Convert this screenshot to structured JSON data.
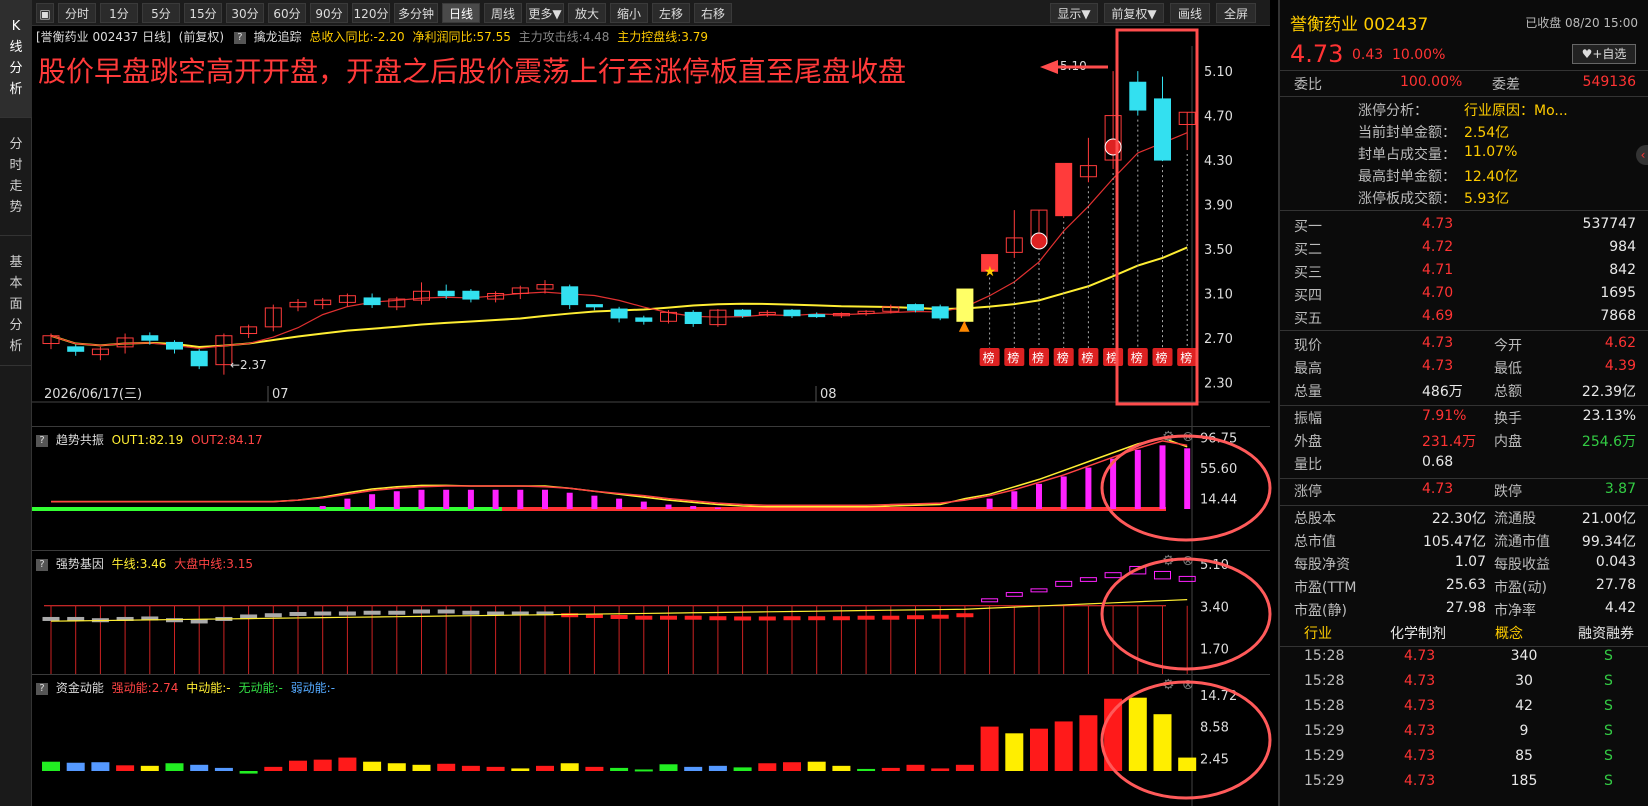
{
  "left_tabs": [
    {
      "label": "K线分析"
    },
    {
      "label": "分时走势"
    },
    {
      "label": "基本面分析"
    }
  ],
  "toolbar": {
    "periods": [
      "分时",
      "1分",
      "5分",
      "15分",
      "30分",
      "60分",
      "90分",
      "120分",
      "多分钟",
      "日线",
      "周线",
      "更多▼",
      "放大",
      "缩小",
      "左移",
      "右移"
    ],
    "active": "日线",
    "right": [
      "显示▼",
      "前复权▼",
      "画线",
      "全屏"
    ]
  },
  "main": {
    "stock_label": "[誉衡药业 002437 日线]",
    "adj": "(前复权)",
    "q": "?",
    "indicator": "擒龙追踪",
    "rev": "总收入同比:-2.20",
    "profit": "净利润同比:57.55",
    "atk": "主力攻击线:4.48",
    "ctrl": "主力控盘线:3.79",
    "annotation": "股价早盘跳空高开开盘，开盘之后股价震荡上行至涨停板直至尾盘收盘",
    "high_label": "5.10",
    "low_label": "2.37",
    "date_label": "2026/06/17(三)",
    "month_07": "07",
    "month_08": "08",
    "bang": "榜",
    "y_labels": [
      "5.10",
      "4.70",
      "4.30",
      "3.90",
      "3.50",
      "3.10",
      "2.70",
      "2.30"
    ]
  },
  "trend": {
    "name": "趋势共振",
    "out1": "OUT1:82.19",
    "out2": "OUT2:84.17",
    "y_labels": [
      "96.75",
      "55.60",
      "14.44"
    ]
  },
  "strong": {
    "name": "强势基因",
    "bull": "牛线:3.46",
    "mid": "大盘中线:3.15",
    "y_labels": [
      "5.10",
      "3.40",
      "1.70"
    ]
  },
  "fund": {
    "name": "资金动能",
    "strong": "强动能:2.74",
    "mid": "中动能:-",
    "none": "无动能:-",
    "weak": "弱动能:-",
    "y_labels": [
      "14.72",
      "8.58",
      "2.45"
    ]
  },
  "candles": [
    [
      2.65,
      2.72,
      2.62,
      2.6,
      2.74
    ],
    [
      2.62,
      2.58,
      2.56,
      2.54,
      2.64
    ],
    [
      2.55,
      2.6,
      2.52,
      2.5,
      2.62
    ],
    [
      2.62,
      2.7,
      2.58,
      2.56,
      2.74
    ],
    [
      2.72,
      2.68,
      2.65,
      2.64,
      2.75
    ],
    [
      2.66,
      2.6,
      2.58,
      2.56,
      2.68
    ],
    [
      2.58,
      2.45,
      2.43,
      2.42,
      2.6
    ],
    [
      2.46,
      2.72,
      2.44,
      2.37,
      2.74
    ],
    [
      2.74,
      2.8,
      2.72,
      2.7,
      2.82
    ],
    [
      2.8,
      2.97,
      2.78,
      2.76,
      3.0
    ],
    [
      2.98,
      3.02,
      2.95,
      2.94,
      3.05
    ],
    [
      3.0,
      3.04,
      2.97,
      2.96,
      3.06
    ],
    [
      3.02,
      3.08,
      2.99,
      2.98,
      3.1
    ],
    [
      3.06,
      3.0,
      2.98,
      2.97,
      3.1
    ],
    [
      2.98,
      3.05,
      2.95,
      2.95,
      3.07
    ],
    [
      3.04,
      3.12,
      3.02,
      3.0,
      3.2
    ],
    [
      3.12,
      3.08,
      3.05,
      3.05,
      3.18
    ],
    [
      3.12,
      3.05,
      3.03,
      3.02,
      3.14
    ],
    [
      3.05,
      3.1,
      3.03,
      3.02,
      3.12
    ],
    [
      3.1,
      3.15,
      3.06,
      3.05,
      3.17
    ],
    [
      3.14,
      3.18,
      3.1,
      3.1,
      3.22
    ],
    [
      3.16,
      3.0,
      2.98,
      2.96,
      3.18
    ],
    [
      3.0,
      2.98,
      2.95,
      2.95,
      3.0
    ],
    [
      2.96,
      2.88,
      2.86,
      2.84,
      2.98
    ],
    [
      2.88,
      2.85,
      2.82,
      2.82,
      2.9
    ],
    [
      2.85,
      2.93,
      2.83,
      2.84,
      2.95
    ],
    [
      2.93,
      2.83,
      2.8,
      2.8,
      2.95
    ],
    [
      2.82,
      2.95,
      2.8,
      2.8,
      2.96
    ],
    [
      2.95,
      2.9,
      2.88,
      2.88,
      2.96
    ],
    [
      2.92,
      2.93,
      2.9,
      2.89,
      2.95
    ],
    [
      2.95,
      2.9,
      2.88,
      2.88,
      2.96
    ],
    [
      2.91,
      2.9,
      2.89,
      2.88,
      2.93
    ],
    [
      2.9,
      2.92,
      2.88,
      2.88,
      2.93
    ],
    [
      2.92,
      2.94,
      2.9,
      2.9,
      2.95
    ],
    [
      2.94,
      2.98,
      2.92,
      2.92,
      3.0
    ],
    [
      3.0,
      2.95,
      2.93,
      2.93,
      3.01
    ],
    [
      2.98,
      2.88,
      2.86,
      2.86,
      3.0
    ],
    [
      2.85,
      3.14,
      2.83,
      2.82,
      3.14
    ],
    [
      3.3,
      3.45,
      3.28,
      3.3,
      3.45
    ],
    [
      3.47,
      3.6,
      3.43,
      3.42,
      3.85
    ],
    [
      3.55,
      3.85,
      3.5,
      3.5,
      3.85
    ],
    [
      3.8,
      4.27,
      3.78,
      3.78,
      4.27
    ],
    [
      4.15,
      4.25,
      4.12,
      4.1,
      4.5
    ],
    [
      4.3,
      4.7,
      4.28,
      4.22,
      5.1
    ],
    [
      5.0,
      4.75,
      4.73,
      4.7,
      5.1
    ],
    [
      4.85,
      4.3,
      4.29,
      4.29,
      5.05
    ],
    [
      4.62,
      4.73,
      4.45,
      4.39,
      4.73
    ]
  ],
  "trend_values": [
    0,
    0,
    0,
    0,
    0,
    0,
    0,
    0,
    0,
    0,
    0,
    4,
    14,
    20,
    24,
    26,
    26,
    26,
    26,
    26,
    26,
    22,
    18,
    14,
    10,
    6,
    4,
    2,
    0,
    0,
    0,
    0,
    0,
    0,
    0,
    0,
    0,
    0,
    14,
    24,
    34,
    44,
    56,
    68,
    80,
    86,
    82
  ],
  "trend_line1": [
    10,
    10,
    10,
    10,
    10,
    10,
    10,
    10,
    10,
    10,
    12,
    16,
    22,
    27,
    30,
    32,
    32,
    31,
    31,
    31,
    31,
    28,
    24,
    20,
    16,
    12,
    9,
    6,
    4,
    3,
    3,
    3,
    3,
    3,
    4,
    5,
    6,
    14,
    20,
    30,
    40,
    52,
    64,
    76,
    88,
    96,
    84
  ],
  "trend_line2": [
    10,
    10,
    10,
    10,
    10,
    10,
    10,
    10,
    10,
    10,
    12,
    15,
    20,
    25,
    28,
    30,
    31,
    31,
    31,
    31,
    30,
    28,
    24,
    21,
    18,
    14,
    11,
    8,
    6,
    5,
    5,
    5,
    5,
    5,
    6,
    7,
    8,
    12,
    18,
    26,
    36,
    46,
    58,
    70,
    82,
    92,
    86
  ],
  "strong_bars": [
    [
      2.9,
      2.95
    ],
    [
      2.9,
      2.95
    ],
    [
      2.85,
      2.9
    ],
    [
      2.9,
      2.95
    ],
    [
      2.92,
      2.97
    ],
    [
      2.86,
      2.9
    ],
    [
      2.78,
      2.85
    ],
    [
      2.85,
      2.95
    ],
    [
      2.95,
      3.05
    ],
    [
      3.05,
      3.1
    ],
    [
      3.1,
      3.15
    ],
    [
      3.12,
      3.17
    ],
    [
      3.12,
      3.17
    ],
    [
      3.15,
      3.2
    ],
    [
      3.15,
      3.2
    ],
    [
      3.2,
      3.25
    ],
    [
      3.2,
      3.25
    ],
    [
      3.15,
      3.2
    ],
    [
      3.12,
      3.17
    ],
    [
      3.12,
      3.17
    ],
    [
      3.12,
      3.17
    ],
    [
      3.05,
      3.1
    ],
    [
      3.02,
      3.07
    ],
    [
      2.98,
      3.03
    ],
    [
      2.95,
      3.0
    ],
    [
      2.95,
      3.0
    ],
    [
      2.95,
      3.0
    ],
    [
      2.93,
      2.98
    ],
    [
      2.92,
      2.97
    ],
    [
      2.92,
      2.97
    ],
    [
      2.93,
      2.98
    ],
    [
      2.93,
      2.98
    ],
    [
      2.93,
      2.98
    ],
    [
      2.95,
      3.0
    ],
    [
      2.95,
      3.0
    ],
    [
      2.96,
      3.02
    ],
    [
      2.98,
      3.04
    ],
    [
      3.0,
      3.1
    ],
    [
      3.6,
      3.7
    ],
    [
      3.8,
      3.95
    ],
    [
      4.0,
      4.1
    ],
    [
      4.2,
      4.4
    ],
    [
      4.4,
      4.55
    ],
    [
      4.55,
      4.75
    ],
    [
      4.7,
      5.0
    ],
    [
      4.5,
      4.8
    ],
    [
      4.4,
      4.6
    ]
  ],
  "fund_values": [
    1.8,
    1.6,
    1.7,
    1.1,
    1.0,
    1.5,
    1.2,
    0.6,
    -0.5,
    0.8,
    2.0,
    2.2,
    2.6,
    1.8,
    1.5,
    1.2,
    1.4,
    1.0,
    0.8,
    0.5,
    1.0,
    1.5,
    0.8,
    0.6,
    0.3,
    1.3,
    0.8,
    1.0,
    0.7,
    1.5,
    1.7,
    1.8,
    1.0,
    0.4,
    0.6,
    1.2,
    0.5,
    1.2,
    8.6,
    7.3,
    8.2,
    9.6,
    10.8,
    14.0,
    14.2,
    11.0,
    2.6
  ],
  "fund_colors": [
    "green",
    "blue",
    "blue",
    "red",
    "yellow",
    "green",
    "blue",
    "blue",
    "green",
    "red",
    "red",
    "red",
    "red",
    "yellow",
    "yellow",
    "yellow",
    "red",
    "red",
    "red",
    "yellow",
    "red",
    "yellow",
    "red",
    "green",
    "green",
    "green",
    "blue",
    "blue",
    "green",
    "red",
    "red",
    "yellow",
    "yellow",
    "green",
    "red",
    "red",
    "red",
    "red",
    "red",
    "yellow",
    "red",
    "red",
    "red",
    "red",
    "yellow",
    "yellow",
    "yellow"
  ],
  "right": {
    "title": "誉衡药业 002437",
    "status": "已收盘 08/20 15:00",
    "price": "4.73",
    "chg": "0.43",
    "pct": "10.00%",
    "self_btn": "+自选",
    "wb_label": "委比",
    "wb_val": "100.00%",
    "wc_label": "委差",
    "wc_val": "549136",
    "limit": [
      {
        "k": "涨停分析：",
        "v": "行业原因：Mo..."
      },
      {
        "k": "当前封单金额：",
        "v": "2.54亿"
      },
      {
        "k": "封单占成交量：",
        "v": "11.07%"
      },
      {
        "k": "最高封单金额：",
        "v": "12.40亿"
      },
      {
        "k": "涨停板成交额：",
        "v": "5.93亿"
      }
    ],
    "bids": [
      {
        "k": "买一",
        "p": "4.73",
        "v": "537747"
      },
      {
        "k": "买二",
        "p": "4.72",
        "v": "984"
      },
      {
        "k": "买三",
        "p": "4.71",
        "v": "842"
      },
      {
        "k": "买四",
        "p": "4.70",
        "v": "1695"
      },
      {
        "k": "买五",
        "p": "4.69",
        "v": "7868"
      }
    ],
    "stats": [
      [
        {
          "k": "现价",
          "v": "4.73",
          "c": "red"
        },
        {
          "k": "今开",
          "v": "4.62",
          "c": "red"
        }
      ],
      [
        {
          "k": "最高",
          "v": "4.73",
          "c": "red"
        },
        {
          "k": "最低",
          "v": "4.39",
          "c": "red"
        }
      ],
      [
        {
          "k": "总量",
          "v": "486万",
          "c": "white"
        },
        {
          "k": "总额",
          "v": "22.39亿",
          "c": "white"
        }
      ]
    ],
    "stats2": [
      [
        {
          "k": "振幅",
          "v": "7.91%",
          "c": "red"
        },
        {
          "k": "换手",
          "v": "23.13%",
          "c": "white"
        }
      ],
      [
        {
          "k": "外盘",
          "v": "231.4万",
          "c": "red"
        },
        {
          "k": "内盘",
          "v": "254.6万",
          "c": "green"
        }
      ],
      [
        {
          "k": "量比",
          "v": "0.68",
          "c": "white"
        }
      ]
    ],
    "stats3": [
      [
        {
          "k": "涨停",
          "v": "4.73",
          "c": "red"
        },
        {
          "k": "跌停",
          "v": "3.87",
          "c": "green"
        }
      ]
    ],
    "fundamentals": [
      [
        {
          "k": "总股本",
          "v": "22.30亿"
        },
        {
          "k": "流通股",
          "v": "21.00亿"
        }
      ],
      [
        {
          "k": "总市值",
          "v": "105.47亿"
        },
        {
          "k": "流通市值",
          "v": "99.34亿"
        }
      ],
      [
        {
          "k": "每股净资",
          "v": "1.07"
        },
        {
          "k": "每股收益",
          "v": "0.043"
        }
      ],
      [
        {
          "k": "市盈(TTM",
          "v": "25.63"
        },
        {
          "k": "市盈(动)",
          "v": "27.78"
        }
      ],
      [
        {
          "k": "市盈(静)",
          "v": "27.98"
        },
        {
          "k": "市净率",
          "v": "4.42"
        }
      ]
    ],
    "tags": [
      "行业",
      "化学制剂",
      "概念",
      "融资融券"
    ],
    "ticks": [
      {
        "t": "15:28",
        "p": "4.73",
        "v": "340",
        "s": "S"
      },
      {
        "t": "15:28",
        "p": "4.73",
        "v": "30",
        "s": "S"
      },
      {
        "t": "15:28",
        "p": "4.73",
        "v": "42",
        "s": "S"
      },
      {
        "t": "15:29",
        "p": "4.73",
        "v": "9",
        "s": "S"
      },
      {
        "t": "15:29",
        "p": "4.73",
        "v": "85",
        "s": "S"
      },
      {
        "t": "15:29",
        "p": "4.73",
        "v": "185",
        "s": "S"
      }
    ],
    "collapse_icon": "‹"
  }
}
